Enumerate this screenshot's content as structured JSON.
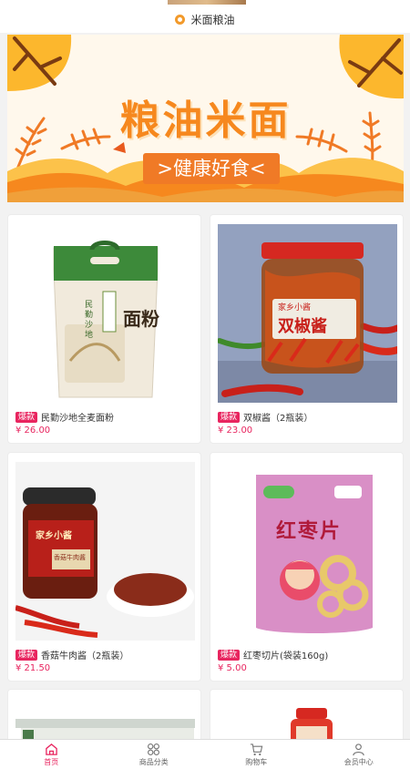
{
  "section": {
    "title": "米面粮油"
  },
  "banner": {
    "title": "粮油米面",
    "subtitle": ">健康好食<"
  },
  "products": [
    {
      "tag": "爆款",
      "name": "民勤沙地全麦面粉",
      "price": "¥ 26.00"
    },
    {
      "tag": "爆款",
      "name": "双椒酱（2瓶装）",
      "price": "¥ 23.00"
    },
    {
      "tag": "爆款",
      "name": "香菇牛肉酱（2瓶装）",
      "price": "¥ 21.50"
    },
    {
      "tag": "爆款",
      "name": "红枣切片(袋装160g)",
      "price": "¥ 5.00"
    }
  ],
  "product_art": {
    "flour_side": "民勤沙地",
    "flour_main": "面粉",
    "sauce_brand": "家乡小酱",
    "sauce_name": "双椒酱",
    "beef_brand": "家乡小酱",
    "beef_name": "香菇牛肉酱",
    "dates_name": "红枣片"
  },
  "tabbar": [
    {
      "label": "首页",
      "icon": "home-icon",
      "active": true
    },
    {
      "label": "商品分类",
      "icon": "category-icon",
      "active": false
    },
    {
      "label": "购物车",
      "icon": "cart-icon",
      "active": false
    },
    {
      "label": "会员中心",
      "icon": "user-icon",
      "active": false
    }
  ],
  "colors": {
    "accent": "#e8255f",
    "banner_orange": "#f6881e",
    "banner_yellow": "#fcb72d"
  }
}
